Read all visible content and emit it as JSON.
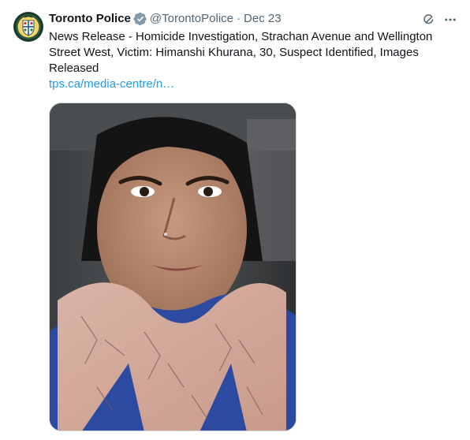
{
  "tweet": {
    "display_name": "Toronto Police",
    "handle": "@TorontoPolice",
    "separator": "·",
    "date": "Dec 23",
    "text": "News Release - Homicide Investigation, Strachan Avenue and Wellington Street West, Victim: Himanshi Khurana, 30, Suspect Identified, Images Released",
    "link_text": "tps.ca/media-centre/n…",
    "icons": {
      "avatar": "toronto-police-crest",
      "verified": "verified-badge",
      "grok": "grok-icon",
      "more": "more-icon"
    },
    "media": {
      "description_visible": false
    }
  },
  "colors": {
    "link": "#1d9bf0",
    "secondary_text": "#536471",
    "primary_text": "#0f1419",
    "badge": "#829aab"
  }
}
